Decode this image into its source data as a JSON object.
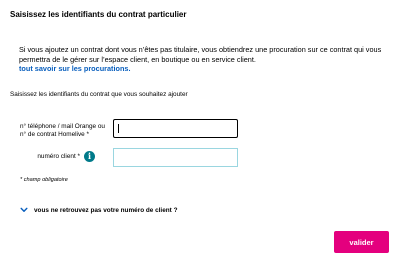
{
  "header": {
    "title": "Saisissez les identifiants du contrat particulier"
  },
  "info": {
    "text": "Si vous ajoutez un contrat dont vous n’êtes pas titulaire, vous obtiendrez une procuration sur ce contrat qui vous permettra de le gérer sur l’espace client, en boutique ou en service client.",
    "link_label": "tout savoir sur les procurations."
  },
  "form": {
    "section_title": "Saisissez les identifiants du contrat que vous souhaitez ajouter",
    "phone_label": "n° téléphone / mail Orange ou n° de contrat Homelive *",
    "phone_value": "",
    "client_label": "numéro client *",
    "client_value": "",
    "info_icon": "info-icon",
    "required_note": "* champ obligatoire",
    "toggle_label": "vous ne retrouvez pas votre numéro de client ?",
    "submit_label": "valider"
  },
  "colors": {
    "accent_pink": "#e4007e",
    "link_blue": "#085ebd",
    "info_teal": "#007a8a",
    "input_focus_border": "#9ad6e0"
  }
}
